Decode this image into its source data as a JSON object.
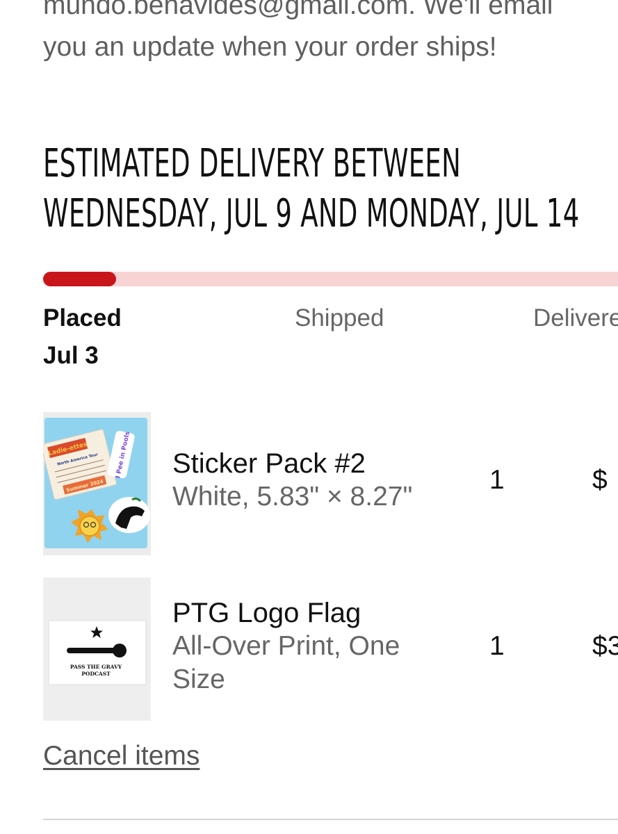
{
  "confirmation": {
    "line1": "mundo.benavides@gmail.com. We'll email",
    "line2": "you an update when your order ships!"
  },
  "delivery": {
    "line1": "Estimated delivery between",
    "line2": "Wednesday, Jul 9 and Monday, Jul 14"
  },
  "progress": {
    "fraction": 0.125,
    "fill_color": "#c8161b",
    "track_color": "#f7d3d4"
  },
  "steps": [
    {
      "label": "Placed",
      "date": "Jul 3",
      "status": "done"
    },
    {
      "label": "Shipped",
      "date": "",
      "status": "pending"
    },
    {
      "label": "Delivered",
      "date": "",
      "status": "pending"
    }
  ],
  "items": [
    {
      "name": "Sticker Pack #2",
      "variant": "White, 5.83\" × 8.27\"",
      "quantity": "1",
      "price": "$",
      "thumbnail": {
        "stickers": [
          "Ladie-ettes",
          "North America Tour",
          "Summer 2024",
          "I Pee in Pools"
        ]
      }
    },
    {
      "name": "PTG Logo Flag",
      "variant": "All-Over Print, One Size",
      "quantity": "1",
      "price": "$3",
      "thumbnail": {
        "flag_line1": "PASS THE GRAVY",
        "flag_line2": "PODCAST"
      }
    }
  ],
  "cancel_label": "Cancel items"
}
